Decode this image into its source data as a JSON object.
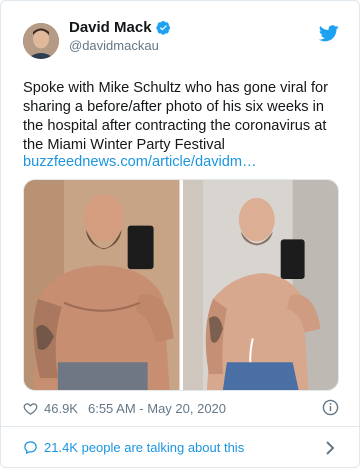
{
  "author": {
    "name": "David Mack",
    "handle": "@davidmackau"
  },
  "tweet": {
    "text": "Spoke with Mike Schultz who has gone viral for sharing a before/after photo of his six weeks in the hospital after contracting the coronavirus at the Miami Winter Party Festival",
    "link": "buzzfeednews.com/article/davidm…"
  },
  "meta": {
    "likes": "46.9K",
    "timestamp": "6:55 AM - May 20, 2020"
  },
  "footer": {
    "talking": "21.4K people are talking about this"
  },
  "colors": {
    "accent": "#1b95e0",
    "muted": "#657786",
    "border": "#e1e8ed"
  },
  "icons": [
    "verified-badge-icon",
    "twitter-bird-icon",
    "heart-icon",
    "info-icon",
    "speech-bubble-icon",
    "chevron-right-icon"
  ]
}
